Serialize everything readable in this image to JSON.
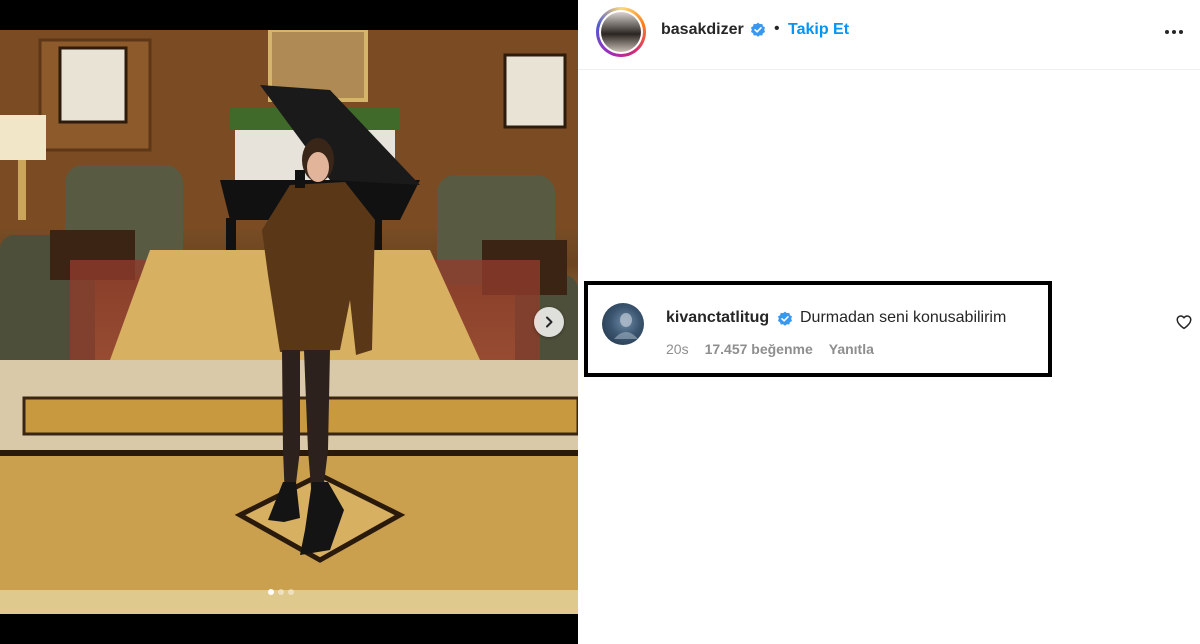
{
  "post": {
    "author": "basakdizer",
    "separator": "•",
    "follow_label": "Takip Et",
    "more_icon": "more-horizontal-icon",
    "carousel": {
      "slide_count": 3,
      "active_slide": 1
    }
  },
  "comment": {
    "username": "kivanctatlitug",
    "text": "Durmadan seni konusabilirim",
    "time": "20s",
    "likes": "17.457 beğenme",
    "reply_label": "Yanıtla"
  },
  "colors": {
    "verified": "#3897f0",
    "link": "#0095f6",
    "muted": "#8e8e8e"
  }
}
